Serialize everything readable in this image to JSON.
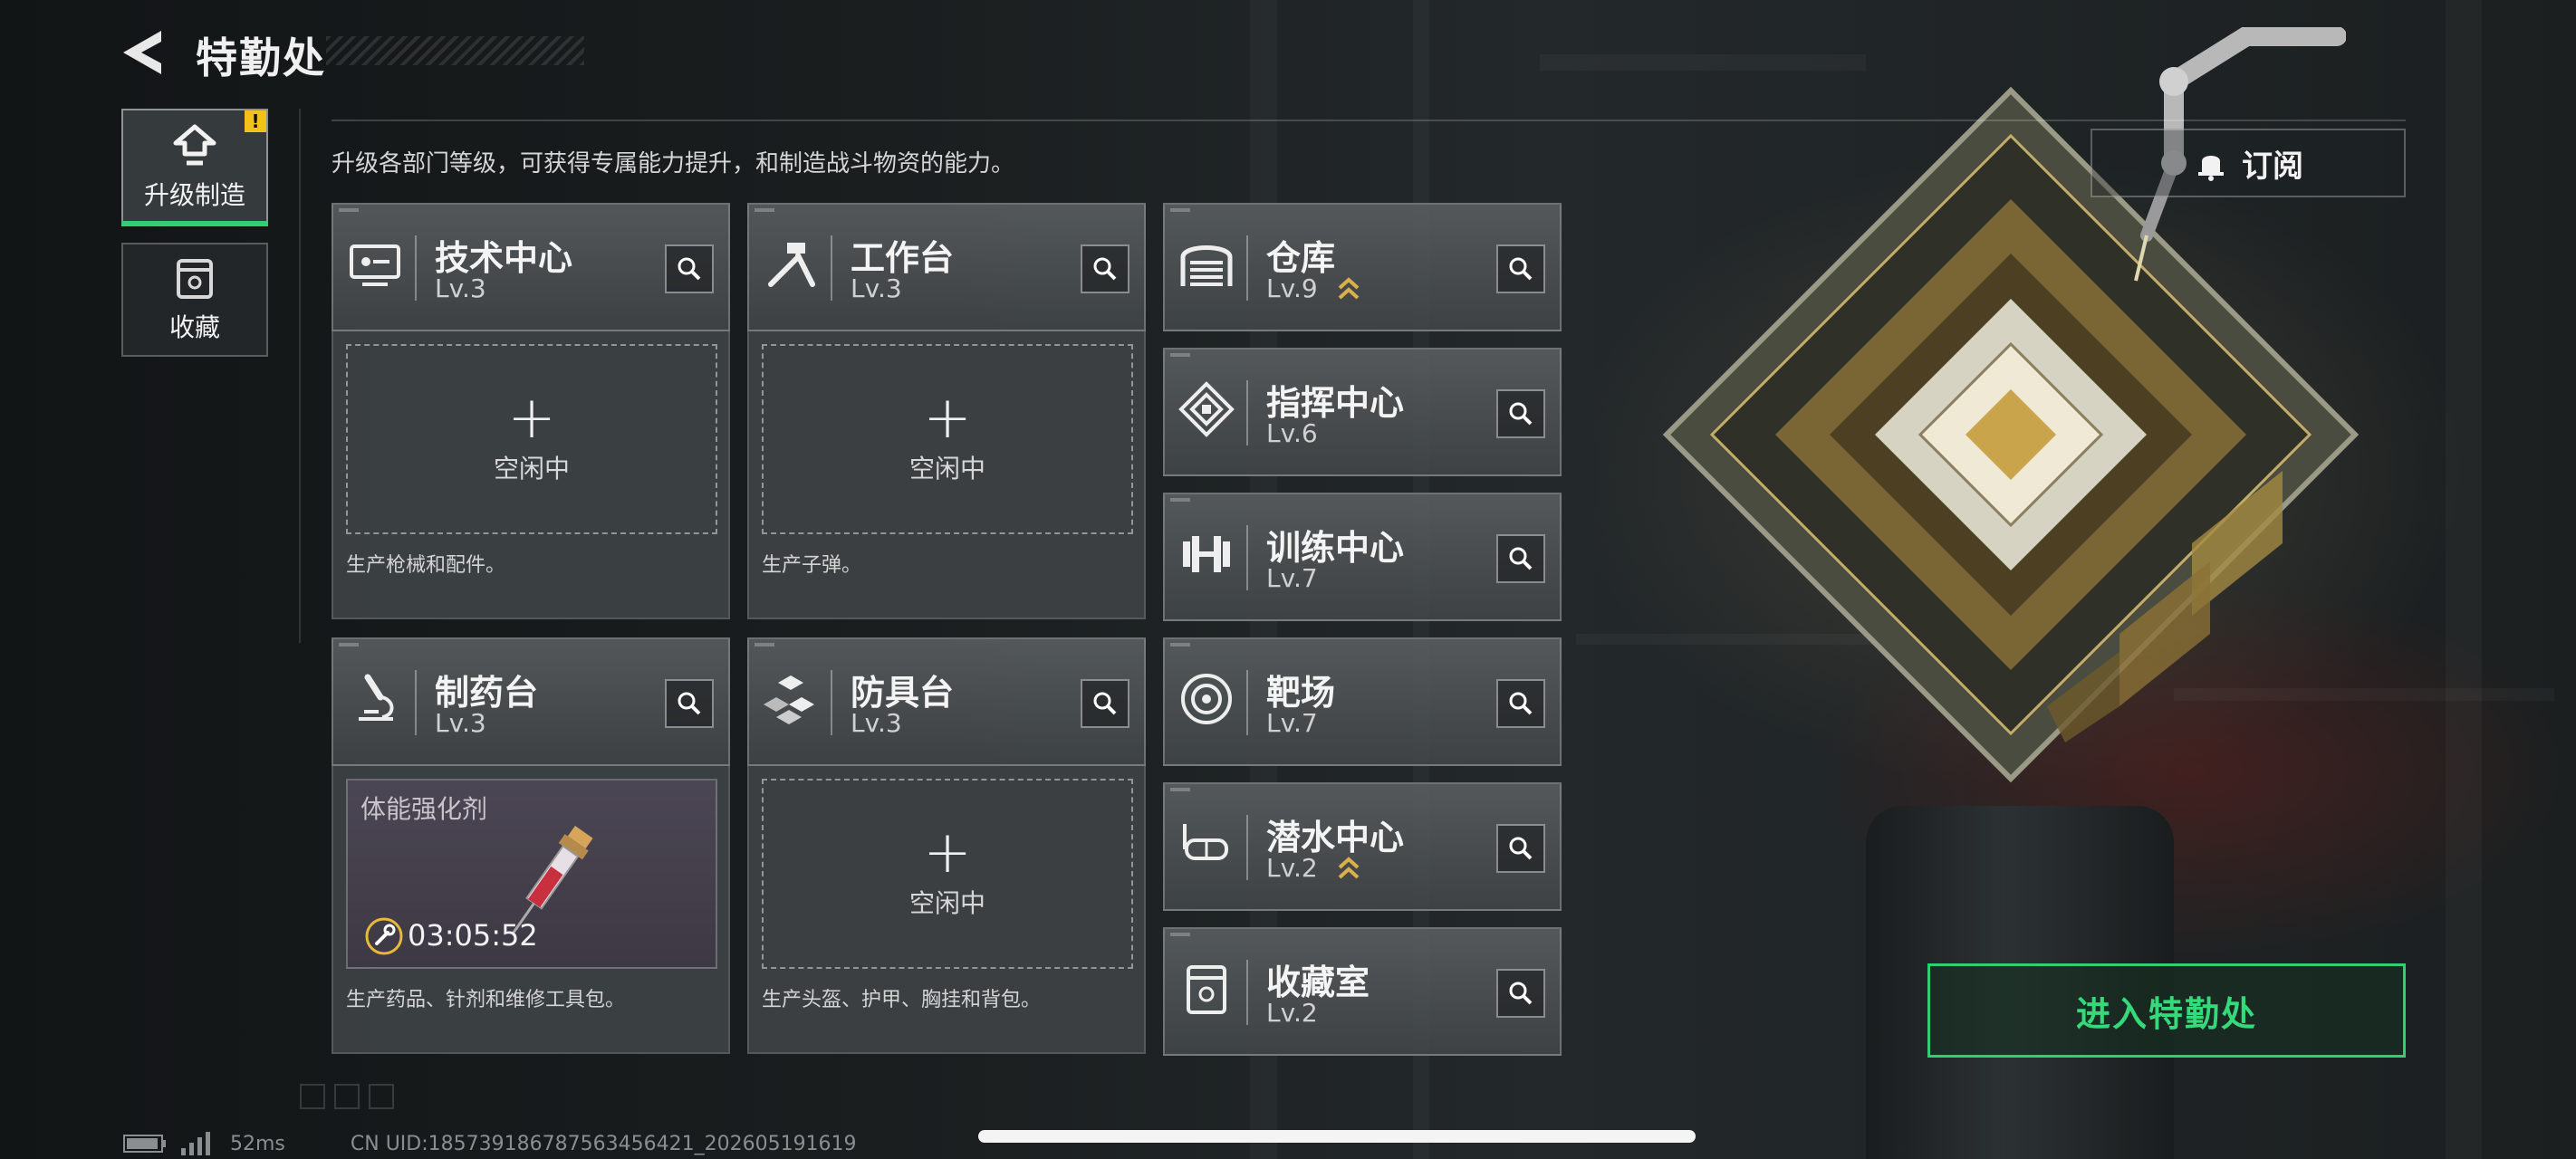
{
  "header": {
    "title": "特勤处"
  },
  "side_tabs": [
    {
      "label": "升级制造",
      "icon": "upgrade-arrow-icon",
      "active": true,
      "badge": "!"
    },
    {
      "label": "收藏",
      "icon": "collection-box-icon",
      "active": false
    }
  ],
  "description": "升级各部门等级，可获得专属能力提升，和制造战斗物资的能力。",
  "facilities": [
    {
      "id": "tech",
      "name": "技术中心",
      "level": "Lv.3",
      "icon": "computer-icon",
      "panel": {
        "state": "idle",
        "plus": "+",
        "status": "空闲中",
        "produces": "生产枪械和配件。"
      }
    },
    {
      "id": "workbench",
      "name": "工作台",
      "level": "Lv.3",
      "icon": "tools-icon",
      "panel": {
        "state": "idle",
        "plus": "+",
        "status": "空闲中",
        "produces": "生产子弹。"
      }
    },
    {
      "id": "warehouse",
      "name": "仓库",
      "level": "Lv.9",
      "icon": "warehouse-icon",
      "upgradable": true
    },
    {
      "id": "command",
      "name": "指挥中心",
      "level": "Lv.6",
      "icon": "command-chip-icon"
    },
    {
      "id": "training",
      "name": "训练中心",
      "level": "Lv.7",
      "icon": "dumbbell-icon"
    },
    {
      "id": "pharmacy",
      "name": "制药台",
      "level": "Lv.3",
      "icon": "microscope-icon",
      "panel": {
        "state": "crafting",
        "item": "体能强化剂",
        "timer": "03:05:52",
        "produces": "生产药品、针剂和维修工具包。"
      }
    },
    {
      "id": "armor",
      "name": "防具台",
      "level": "Lv.3",
      "icon": "cubes-icon",
      "panel": {
        "state": "idle",
        "plus": "+",
        "status": "空闲中",
        "produces": "生产头盔、护甲、胸挂和背包。"
      }
    },
    {
      "id": "range",
      "name": "靶场",
      "level": "Lv.7",
      "icon": "target-icon"
    },
    {
      "id": "diving",
      "name": "潜水中心",
      "level": "Lv.2",
      "icon": "diving-mask-icon",
      "upgradable": true
    },
    {
      "id": "collection",
      "name": "收藏室",
      "level": "Lv.2",
      "icon": "collection-box-icon"
    }
  ],
  "subscribe": {
    "label": "订阅",
    "icon": "bell-icon"
  },
  "enter_button": {
    "label": "进入特勤处"
  },
  "status_bar": {
    "ping": "52ms",
    "uid": "CN UID:18573918678756345642​1_202605191619"
  },
  "colors": {
    "accent_green": "#2fcf72",
    "badge_yellow": "#f2c21b",
    "upgrade_gold": "#d9b04a"
  }
}
